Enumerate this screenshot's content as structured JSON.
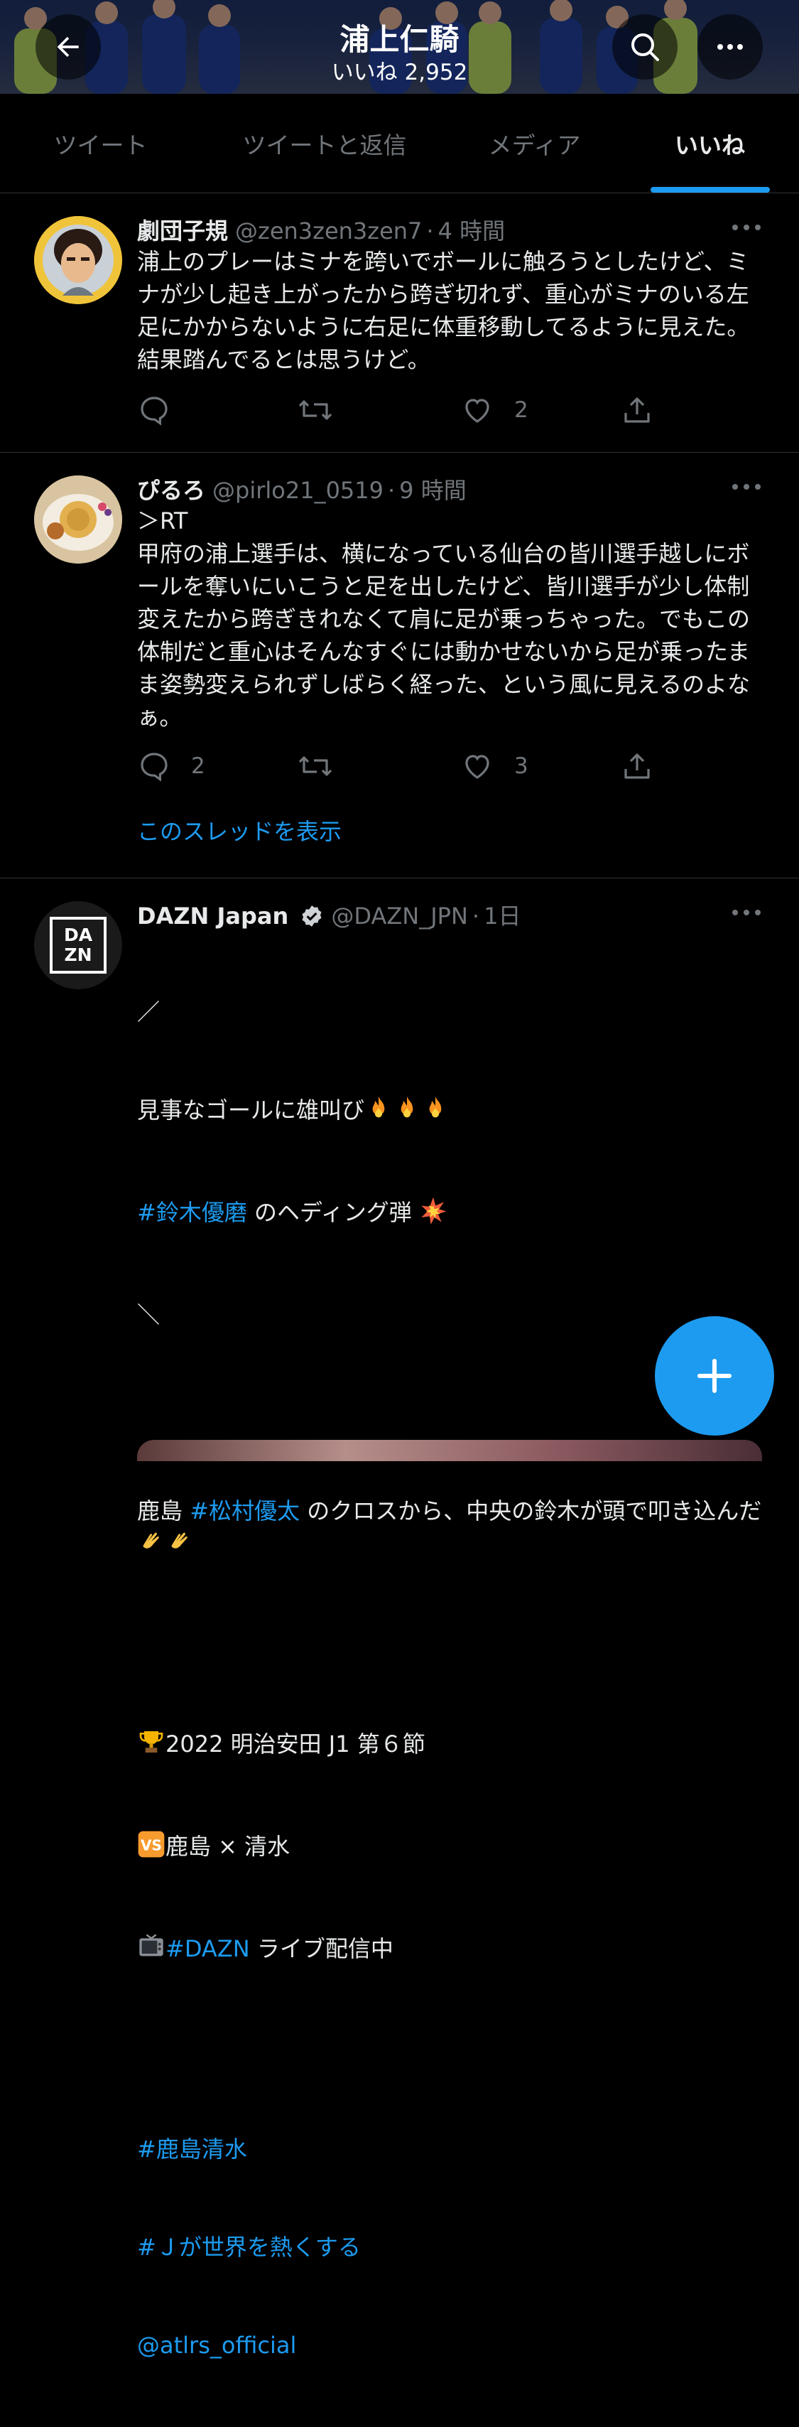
{
  "header": {
    "title": "浦上仁騎",
    "likes_label": "いいね 2,952",
    "back_icon": "arrow-left-icon",
    "search_icon": "search-icon",
    "more_icon": "more-horizontal-icon"
  },
  "tabs": [
    {
      "label": "ツイート",
      "active": false
    },
    {
      "label": "ツイートと返信",
      "active": false
    },
    {
      "label": "メディア",
      "active": false
    },
    {
      "label": "いいね",
      "active": true
    }
  ],
  "tweets": [
    {
      "name": "劇団子規",
      "handle": "@zen3zen3zen7",
      "time": "4 時間",
      "body": "浦上のプレーはミナを跨いでボールに触ろうとしたけど、ミナが少し起き上がったから跨ぎ切れず、重心がミナのいる左足にかからないように右足に体重移動してるように見えた。結果踏んでるとは思うけど。",
      "reply_count": "",
      "retweet_count": "",
      "like_count": "2"
    },
    {
      "name": "ぴるろ",
      "handle": "@pirlo21_0519",
      "time": "9 時間",
      "body": "＞RT\n甲府の浦上選手は、横になっている仙台の皆川選手越しにボールを奪いにいこうと足を出したけど、皆川選手が少し体制変えたから跨ぎきれなくて肩に足が乗っちゃった。でもこの体制だと重心はそんなすぐには動かせないから足が乗ったまま姿勢変えられずしばらく経った、という風に見えるのよなぁ。",
      "reply_count": "2",
      "retweet_count": "",
      "like_count": "3",
      "thread_link": "このスレッドを表示"
    },
    {
      "name": "DAZN Japan",
      "handle": "@DAZN_JPN",
      "time": "1日",
      "verified": true,
      "avatar_text_top": "DA",
      "avatar_text_bottom": "ZN",
      "lines": {
        "l1": "／",
        "l2": "見事なゴールに雄叫び",
        "l3_tag": "#鈴木優磨",
        "l3_rest": " のヘディング弾",
        "l4": "＼",
        "l5_pre": "鹿島 ",
        "l5_tag": "#松村優太",
        "l5_rest": " のクロスから、中央の鈴木が頭で叩き込んだ",
        "l6": "2022 明治安田 J1 第６節",
        "l7": "鹿島 × 清水",
        "l8_tag": "#DAZN",
        "l8_rest": " ライブ配信中",
        "l9": "#鹿島清水",
        "l10": "#Ｊが世界を熱くする",
        "l11": "@atlrs_official"
      },
      "icons": [
        "fire-emoji",
        "collision-emoji",
        "clapping-emoji",
        "trophy-emoji",
        "vs-emoji",
        "tv-emoji"
      ]
    }
  ],
  "colors": {
    "background": "#000000",
    "accent": "#1d9bf0",
    "muted": "#71767b",
    "text": "#e7e9ea"
  },
  "fab_icon": "plus-icon"
}
